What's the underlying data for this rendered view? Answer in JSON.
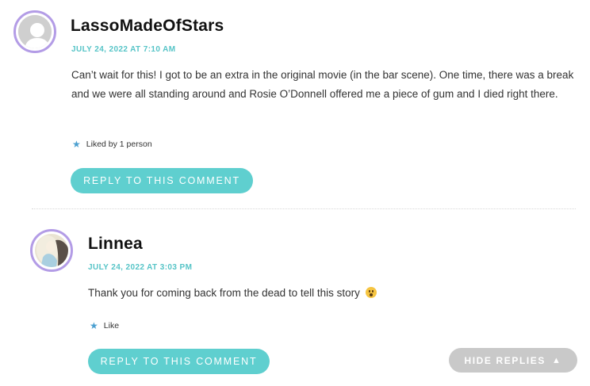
{
  "comments": [
    {
      "author": "LassoMadeOfStars",
      "date": "JULY 24, 2022 AT 7:10 AM",
      "text": "Can’t wait for this! I got to be an extra in the original movie (in the bar scene). One time, there was a break and we were all standing around and Rosie O’Donnell offered me a piece of gum and I died right there.",
      "liked": "Liked by 1 person",
      "reply_label": "REPLY TO THIS COMMENT",
      "avatar": "default-person-icon"
    },
    {
      "author": "Linnea",
      "date": "JULY 24, 2022 AT 3:03 PM",
      "text": "Thank you for coming back from the dead to tell this story",
      "emoji": "astonished-face-icon",
      "liked": "Like",
      "reply_label": "REPLY TO THIS COMMENT",
      "avatar": "user-photo"
    }
  ],
  "hide_replies": {
    "label": "HIDE REPLIES",
    "icon": "triangle-up-icon"
  },
  "colors": {
    "accent": "#5fcfcf",
    "date": "#56c4c7",
    "avatar_ring": "#b39ce6",
    "hide_button": "#c9c9c9"
  }
}
